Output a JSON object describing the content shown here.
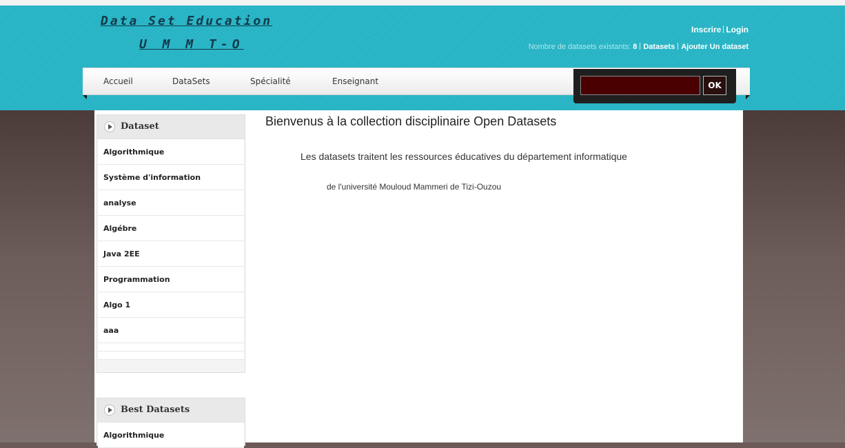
{
  "logo": {
    "line1": "Data Set Education",
    "line2": "U M M T-O"
  },
  "top_links": {
    "inscrire": "Inscrire",
    "login": "Login"
  },
  "stats": {
    "label": "Nombre de datasets existants:",
    "count": "8",
    "datasets_link": "Datasets",
    "add_link": "Ajouter Un dataset"
  },
  "nav": {
    "items": [
      {
        "label": "Accueil"
      },
      {
        "label": "DataSets"
      },
      {
        "label": "Spécialité"
      },
      {
        "label": "Enseignant"
      }
    ]
  },
  "search": {
    "value": "",
    "button_label": "OK"
  },
  "sidebar": {
    "dataset_title": "Dataset",
    "dataset_items": [
      {
        "label": "Algorithmique"
      },
      {
        "label": "Système d'information"
      },
      {
        "label": "analyse"
      },
      {
        "label": "Algébre"
      },
      {
        "label": "Java 2EE"
      },
      {
        "label": "Programmation"
      },
      {
        "label": "Algo 1"
      },
      {
        "label": "aaa"
      }
    ],
    "best_title": "Best Datasets",
    "best_items": [
      {
        "label": "Algorithmique"
      }
    ]
  },
  "main": {
    "title": "Bienvenus à la collection disciplinaire Open Datasets",
    "line1": "Les datasets traitent les ressources éducatives du département informatique",
    "line2": "de l'université Mouloud Mammeri de Tizi-Ouzou"
  },
  "colors": {
    "header_teal": "#27b6c7",
    "logo_text": "#123a4b",
    "search_input_bg": "#4a0000",
    "background_brown": "#6b5a57"
  }
}
